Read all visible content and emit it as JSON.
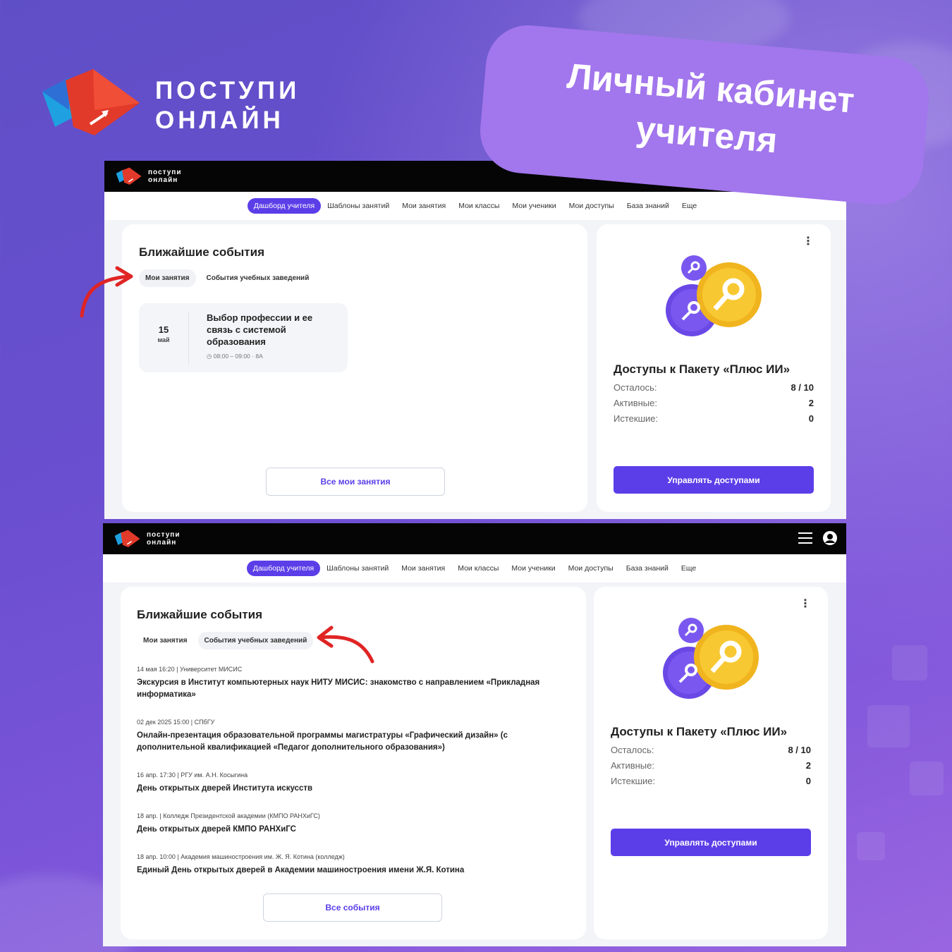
{
  "brand": {
    "line1": "ПОСТУПИ",
    "line2": "ОНЛАЙН",
    "mini_line1": "поступи",
    "mini_line2": "онлайн"
  },
  "banner": {
    "line1": "Личный кабинет",
    "line2": "учителя"
  },
  "nav": {
    "items": [
      "Дашборд учителя",
      "Шаблоны занятий",
      "Мои занятия",
      "Мои классы",
      "Мои ученики",
      "Мои доступы",
      "База знаний",
      "Еще"
    ],
    "active_index": 0
  },
  "events": {
    "title": "Ближайшие события",
    "tabs": [
      "Мои занятия",
      "События учебных заведений"
    ]
  },
  "screen1": {
    "selected_tab": 0,
    "lesson": {
      "day": "15",
      "month": "май",
      "title": "Выбор профессии и ее связь с системой образования",
      "time": "08:00 – 09:00",
      "class": "8А"
    },
    "button": "Все мои занятия"
  },
  "screen2": {
    "selected_tab": 1,
    "events": [
      {
        "meta": "14 мая 16:20 | Университет МИСИС",
        "title": "Экскурсия в Институт компьютерных наук НИТУ МИСИС: знакомство с направлением «Прикладная информатика»"
      },
      {
        "meta": "02 дек 2025 15:00 | СПбГУ",
        "title": "Онлайн-презентация образовательной программы магистратуры «Графический дизайн» (с дополнительной квалификацией «Педагог дополнительного образования»)"
      },
      {
        "meta": "16 апр. 17:30 | РГУ им. А.Н. Косыгина",
        "title": "День открытых дверей Института искусств"
      },
      {
        "meta": "18 апр. | Колледж Президентской академии (КМПО РАНХиГС)",
        "title": "День открытых дверей КМПО РАНХиГС"
      },
      {
        "meta": "18 апр. 10:00 | Академия машиностроения им. Ж. Я. Котина (колледж)",
        "title": "Единый День открытых дверей в Академии машиностроения имени Ж.Я. Котина"
      }
    ],
    "button": "Все события"
  },
  "access": {
    "title": "Доступы к Пакету «Плюс ИИ»",
    "rows": [
      {
        "label": "Осталось:",
        "value": "8 / 10"
      },
      {
        "label": "Активные:",
        "value": "2"
      },
      {
        "label": "Истекшие:",
        "value": "0"
      }
    ],
    "button": "Управлять доступами"
  },
  "colors": {
    "accent": "#5b3ee8",
    "bg": "#6a4fd0",
    "banner": "#a276ec",
    "arrow": "#e02424"
  },
  "icons": [
    "logo-icon",
    "menu-icon",
    "user-icon",
    "clock-icon",
    "key-badge-icon",
    "kebab-icon"
  ]
}
